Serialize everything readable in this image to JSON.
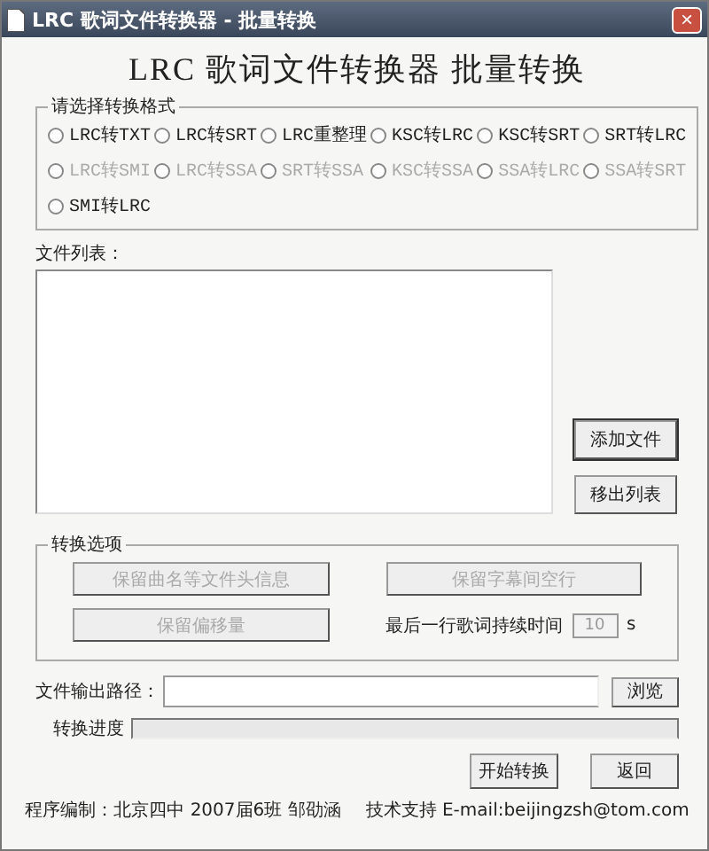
{
  "window": {
    "title": "LRC 歌词文件转换器 - 批量转换",
    "close": "×"
  },
  "heading": "LRC 歌词文件转换器 批量转换",
  "format_group": {
    "title": "请选择转换格式",
    "options": [
      {
        "label": "LRC转TXT",
        "selected": false,
        "disabled": false
      },
      {
        "label": "LRC转SRT",
        "selected": false,
        "disabled": false
      },
      {
        "label": "LRC重整理",
        "selected": false,
        "disabled": false
      },
      {
        "label": "KSC转LRC",
        "selected": false,
        "disabled": false
      },
      {
        "label": "KSC转SRT",
        "selected": false,
        "disabled": false
      },
      {
        "label": "SRT转LRC",
        "selected": false,
        "disabled": false
      },
      {
        "label": "LRC转SMI",
        "selected": false,
        "disabled": true
      },
      {
        "label": "LRC转SSA",
        "selected": false,
        "disabled": true
      },
      {
        "label": "SRT转SSA",
        "selected": false,
        "disabled": true
      },
      {
        "label": "KSC转SSA",
        "selected": false,
        "disabled": true
      },
      {
        "label": "SSA转LRC",
        "selected": false,
        "disabled": true
      },
      {
        "label": "SSA转SRT",
        "selected": false,
        "disabled": true
      },
      {
        "label": "SMI转LRC",
        "selected": false,
        "disabled": false
      }
    ]
  },
  "file_list": {
    "label": "文件列表：",
    "buttons": [
      "添加文件",
      "移出列表"
    ]
  },
  "options_group": {
    "title": "转换选项",
    "buttons": [
      {
        "label": "保留曲名等文件头信息",
        "disabled": true
      },
      {
        "label": "保留字幕间空行",
        "disabled": true
      },
      {
        "label": "保留偏移量",
        "disabled": true
      }
    ],
    "duration_label": "最后一行歌词持续时间",
    "duration_value": "10",
    "duration_unit": "s",
    "duration_disabled": true
  },
  "output": {
    "label": "文件输出路径：",
    "browse": "浏览"
  },
  "progress": {
    "label": "转换进度",
    "level": 0
  },
  "actions": [
    "开始转换",
    "返回"
  ],
  "footer": {
    "credit": "程序编制：北京四中 2007届6班 邹劭涵",
    "support": "技术支持 E-mail:beijingzsh@tom.com"
  }
}
